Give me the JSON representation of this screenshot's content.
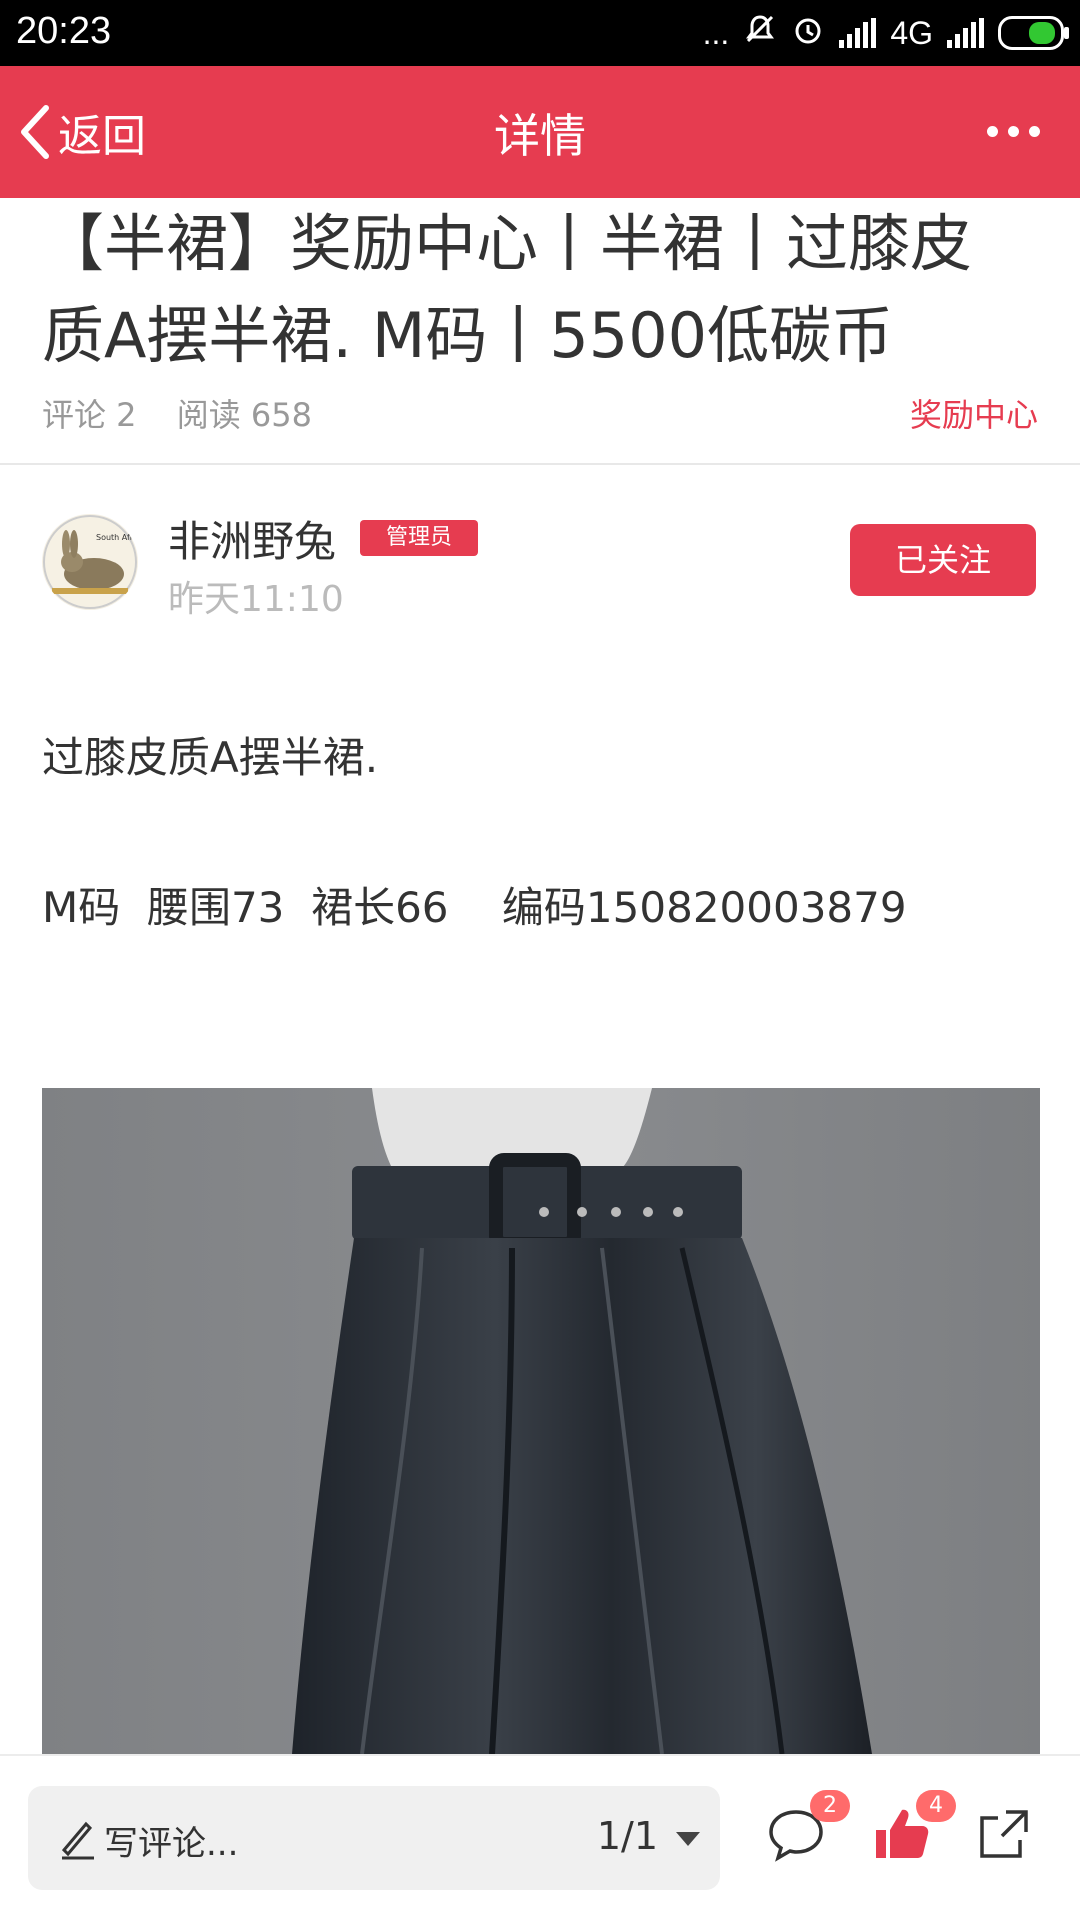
{
  "status_bar": {
    "time": "20:23",
    "dots": "...",
    "network": "4G"
  },
  "header": {
    "back_label": "返回",
    "title": "详情"
  },
  "post": {
    "title_line1": "【半裙】奖励中心丨半裙丨过膝皮",
    "title_line2": "质A摆半裙. M码丨5500低碳币",
    "comments_label": "评论 2",
    "reads_label": "阅读 658",
    "category": "奖励中心"
  },
  "author": {
    "name": "非洲野兔",
    "badge": "管理员",
    "time": "昨天11:10",
    "follow_label": "已关注",
    "avatar_text": "South Africa"
  },
  "content": {
    "line1": "过膝皮质A摆半裙.",
    "line2": "M码  腰围73  裙长66    编码150820003879"
  },
  "bottom_bar": {
    "comment_placeholder": "写评论...",
    "page_indicator": "1/1",
    "comment_count": "2",
    "like_count": "4"
  },
  "colors": {
    "accent": "#e63c50",
    "badge_count": "#ff6b6b"
  },
  "icons": [
    "back-icon",
    "more-icon",
    "pencil-icon",
    "dropdown-icon",
    "comment-icon",
    "like-icon",
    "share-icon"
  ]
}
